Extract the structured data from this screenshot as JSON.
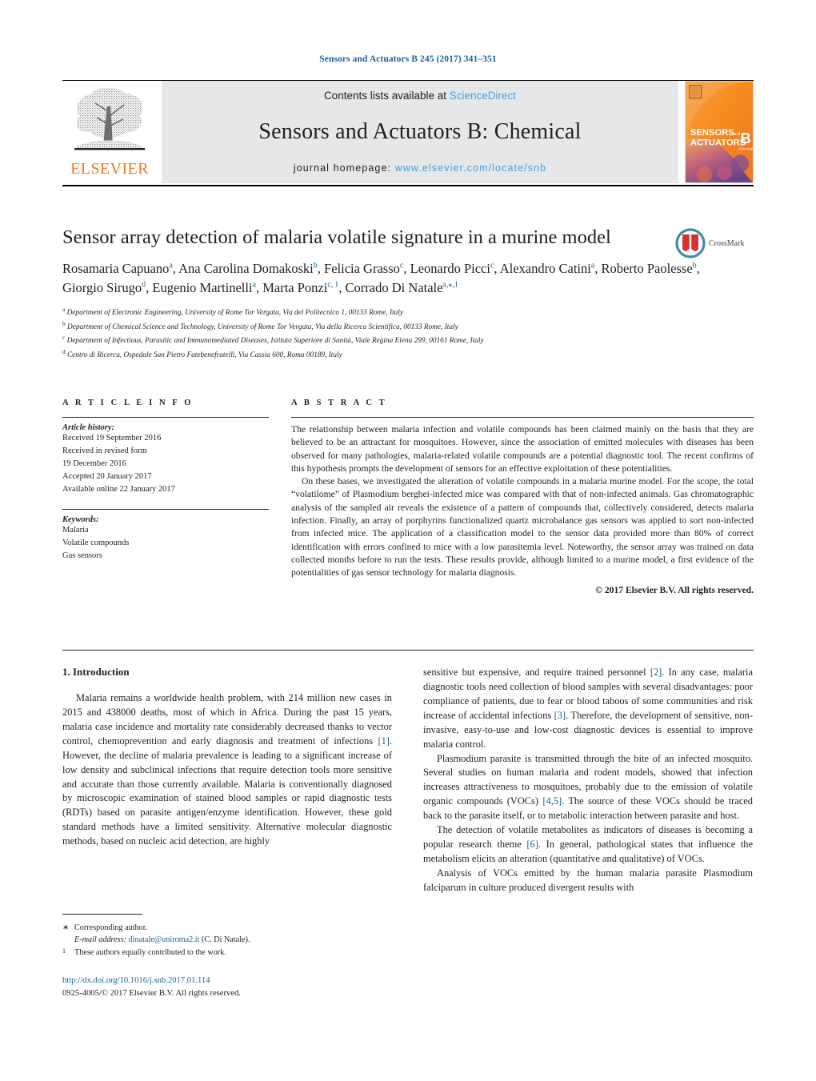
{
  "running_head": "Sensors and Actuators B 245 (2017) 341–351",
  "masthead": {
    "contents_prefix": "Contents lists available at ",
    "sciencedirect": "ScienceDirect",
    "journal_title": "Sensors and Actuators B: Chemical",
    "homepage_prefix": "journal homepage: ",
    "homepage_url": "www.elsevier.com/locate/snb",
    "publisher": "ELSEVIER",
    "cover": {
      "line1": "SENSORS",
      "line1_and": "and",
      "line2": "ACTUATORS",
      "letter": "B",
      "sub": "Chemical"
    }
  },
  "article": {
    "title": "Sensor array detection of malaria volatile signature in a murine model",
    "crossmark_label": "CrossMark",
    "authors_html": "Rosamaria Capuano<sup>a</sup>, Ana Carolina Domakoski<sup>b</sup>, Felicia Grasso<sup>c</sup>, Leonardo Picci<sup>c</sup>, Alexandro Catini<sup>a</sup>, Roberto Paolesse<sup>b</sup>, Giorgio Sirugo<sup>d</sup>, Eugenio Martinelli<sup>a</sup>, Marta Ponzi<sup>c,&#8239;1</sup>, Corrado Di Natale<sup>a,&#8270;,1</sup>",
    "affiliations": [
      {
        "mark": "a",
        "text": "Department of Electronic Engineering, University of Rome Tor Vergata, Via del Politecnico 1, 00133 Rome, Italy"
      },
      {
        "mark": "b",
        "text": "Department of Chemical Science and Technology, University of Rome Tor Vergata, Via della Ricerca Scientifica, 00133 Rome, Italy"
      },
      {
        "mark": "c",
        "text": "Department of Infectious, Parasitic and Immunomediated Diseases, Istituto Superiore di Sanità, Viale Regina Elena 299, 00161 Rome, Italy"
      },
      {
        "mark": "d",
        "text": "Centro di Ricerca, Ospedale San Pietro Fatebenefratelli, Via Cassia 600, Roma 00189, Italy"
      }
    ]
  },
  "article_info": {
    "heading": "A R T I C L E   I N F O",
    "history_label": "Article history:",
    "history": [
      "Received 19 September 2016",
      "Received in revised form",
      "19 December 2016",
      "Accepted 20 January 2017",
      "Available online 22 January 2017"
    ],
    "keywords_label": "Keywords:",
    "keywords": [
      "Malaria",
      "Volatile compounds",
      "Gas sensors"
    ]
  },
  "abstract": {
    "heading": "A B S T R A C T",
    "paragraphs": [
      "The relationship between malaria infection and volatile compounds has been claimed mainly on the basis that they are believed to be an attractant for mosquitoes. However, since the association of emitted molecules with diseases has been observed for many pathologies, malaria-related volatile compounds are a potential diagnostic tool. The recent confirms of this hypothesis prompts the development of sensors for an effective exploitation of these potentialities.",
      "On these bases, we investigated the alteration of volatile compounds in a malaria murine model. For the scope, the total “volatilome” of Plasmodium berghei-infected mice was compared with that of non-infected animals. Gas chromatographic analysis of the sampled air reveals the existence of a pattern of compounds that, collectively considered, detects malaria infection. Finally, an array of porphyrins functionalized quartz microbalance gas sensors was applied to sort non-infected from infected mice. The application of a classification model to the sensor data provided more than 80% of correct identification with errors confined to mice with a low parasitemia level. Noteworthy, the sensor array was trained on data collected months before to run the tests. These results provide, although limited to a murine model, a first evidence of the potentialities of gas sensor technology for malaria diagnosis."
    ],
    "copyright": "© 2017 Elsevier B.V. All rights reserved."
  },
  "body": {
    "section_heading": "1.  Introduction",
    "left_paragraphs_html": [
      "Malaria remains a worldwide health problem, with 214 million new cases in 2015 and 438000 deaths, most of which in Africa. During the past 15 years, malaria case incidence and mortality rate considerably decreased thanks to vector control, chemoprevention and early diagnosis and treatment of infections <span class=\"ref\">[1]</span>. However, the decline of malaria prevalence is leading to a significant increase of low density and subclinical infections that require detection tools more sensitive and accurate than those currently available. Malaria is conventionally diagnosed by microscopic examination of stained blood samples or rapid diagnostic tests (RDTs) based on parasite antigen/enzyme identification. However, these gold standard methods have a limited sensitivity. Alternative molecular diagnostic methods, based on nucleic acid detection, are highly"
    ],
    "right_paragraphs_html": [
      "sensitive but expensive, and require trained personnel <span class=\"ref\">[2]</span>. In any case, malaria diagnostic tools need collection of blood samples with several disadvantages: poor compliance of patients, due to fear or blood taboos of some communities and risk increase of accidental infections <span class=\"ref\">[3]</span>. Therefore, the development of sensitive, non-invasive, easy-to-use and low-cost diagnostic devices is essential to improve malaria control.",
      "Plasmodium parasite is transmitted through the bite of an infected mosquito. Several studies on human malaria and rodent models, showed that infection increases attractiveness to mosquitoes, probably due to the emission of volatile organic compounds (VOCs) <span class=\"ref\">[4,5]</span>. The source of these VOCs should be traced back to the parasite itself, or to metabolic interaction between parasite and host.",
      "The detection of volatile metabolites as indicators of diseases is becoming a popular research theme <span class=\"ref\">[6]</span>. In general, pathological states that influence the metabolism elicits an alteration (quantitative and qualitative) of VOCs.",
      "Analysis of VOCs emitted by the human malaria parasite Plasmodium falciparum in culture produced divergent results with"
    ]
  },
  "footnotes": {
    "corresponding_mark": "∗",
    "corresponding_text": "Corresponding author.",
    "email_label": "E-mail address:",
    "email": "dinatale@uniroma2.it",
    "email_suffix": "(C. Di Natale).",
    "equal_mark": "1",
    "equal_text": "These authors equally contributed to the work."
  },
  "doi": {
    "url": "http://dx.doi.org/10.1016/j.snb.2017.01.114",
    "issn_line": "0925-4005/© 2017 Elsevier B.V. All rights reserved."
  },
  "colors": {
    "link_blue": "#1a6496",
    "sciencedirect_blue": "#4a9fd5",
    "elsevier_orange": "#f47920",
    "banner_grey": "#e6e7e8"
  }
}
